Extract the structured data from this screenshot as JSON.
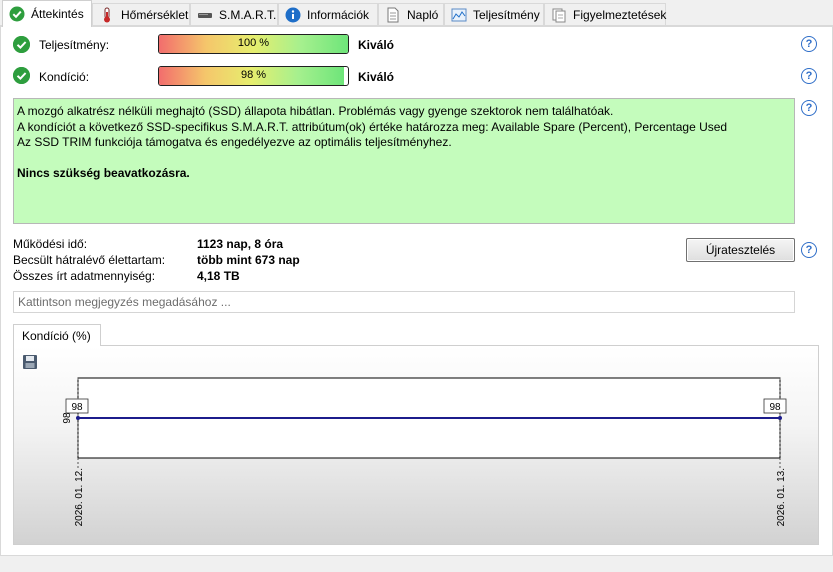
{
  "tabs": [
    {
      "label": "Áttekintés",
      "icon": "check-circle-icon"
    },
    {
      "label": "Hőmérséklet",
      "icon": "thermometer-icon"
    },
    {
      "label": "S.M.A.R.T.",
      "icon": "drive-icon"
    },
    {
      "label": "Információk",
      "icon": "info-icon"
    },
    {
      "label": "Napló",
      "icon": "document-icon"
    },
    {
      "label": "Teljesítmény",
      "icon": "performance-chart-icon"
    },
    {
      "label": "Figyelmeztetések",
      "icon": "alerts-icon"
    }
  ],
  "performance": {
    "label": "Teljesítmény:",
    "value_text": "100 %",
    "value": 100,
    "rating": "Kiváló"
  },
  "condition": {
    "label": "Kondíció:",
    "value_text": "98 %",
    "value": 98,
    "rating": "Kiváló"
  },
  "summary": {
    "line1": "A mozgó alkatrész nélküli meghajtó (SSD) állapota hibátlan. Problémás vagy gyenge szektorok nem találhatóak.",
    "line2": "A kondíciót a következő SSD-specifikus S.M.A.R.T. attribútum(ok) értéke határozza meg:  Available Spare (Percent), Percentage Used",
    "line3": "Az SSD TRIM funkciója támogatva és engedélyezve az optimális teljesítményhez.",
    "line4": "Nincs szükség beavatkozásra."
  },
  "info": {
    "uptime_label": "Működési idő:",
    "uptime_value": "1123 nap, 8 óra",
    "remaining_label": "Becsült hátralévő élettartam:",
    "remaining_value": "több mint 673 nap",
    "written_label": "Összes írt adatmennyiség:",
    "written_value": "4,18 TB"
  },
  "retest_label": "Újratesztelés",
  "help_label": "?",
  "note_placeholder": "Kattintson megjegyzés megadásához ...",
  "chart_tab_label": "Kondíció  (%)",
  "chart_data": {
    "type": "line",
    "x": [
      "2026. 01. 12.",
      "2026. 01. 13."
    ],
    "series": [
      {
        "values": [
          98,
          98
        ]
      }
    ],
    "ytick_labels": [
      "98"
    ],
    "data_labels": [
      "98",
      "98"
    ],
    "ylim": [
      97,
      99
    ],
    "grid": false,
    "color": "#1c1c8c"
  },
  "colors": {
    "summary_bg": "#c4fcbc",
    "check": "#2e9e3e",
    "help": "#2f6ec8"
  }
}
